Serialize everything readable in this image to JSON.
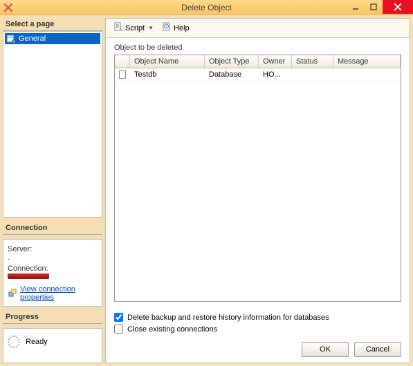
{
  "window": {
    "title": "Delete Object"
  },
  "left": {
    "select_page_header": "Select a page",
    "pages": [
      {
        "label": "General"
      }
    ],
    "connection_header": "Connection",
    "server_label": "Server:",
    "server_value": ".",
    "connection_label": "Connection:",
    "view_props_link": "View connection properties",
    "progress_header": "Progress",
    "progress_status": "Ready"
  },
  "toolbar": {
    "script_label": "Script",
    "help_label": "Help"
  },
  "main": {
    "group_label": "Object to be deleted",
    "columns": {
      "name": "Object Name",
      "type": "Object Type",
      "owner": "Owner",
      "status": "Status",
      "message": "Message"
    },
    "rows": [
      {
        "name": "Testdb",
        "type": "Database",
        "owner": "HO...",
        "status": "",
        "message": ""
      }
    ]
  },
  "options": {
    "delete_backup": {
      "label": "Delete backup and restore history information for databases",
      "checked": true
    },
    "close_conns": {
      "label": "Close existing connections",
      "checked": false
    }
  },
  "buttons": {
    "ok": "OK",
    "cancel": "Cancel"
  }
}
